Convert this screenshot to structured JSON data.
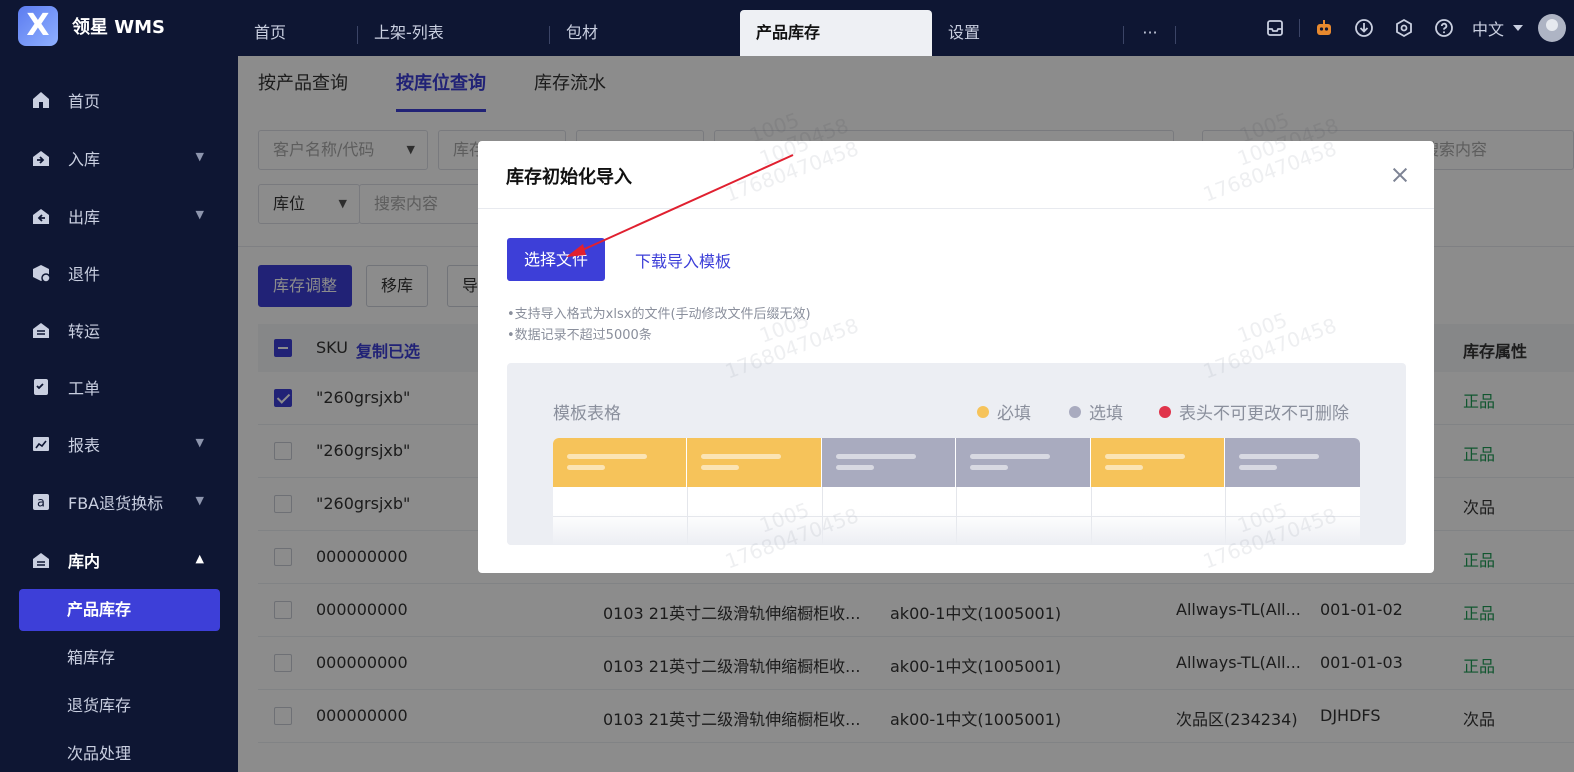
{
  "app": {
    "name": "领星 WMS"
  },
  "topnav": {
    "tabs": [
      {
        "label": "首页"
      },
      {
        "label": "上架-列表"
      },
      {
        "label": "包材"
      },
      {
        "label": "产品库存"
      },
      {
        "label": "设置"
      }
    ],
    "more": "···",
    "lang": "中文"
  },
  "sidebar": {
    "items": [
      {
        "label": "首页",
        "icon": "home-icon"
      },
      {
        "label": "入库",
        "icon": "inbound-icon"
      },
      {
        "label": "出库",
        "icon": "outbound-icon"
      },
      {
        "label": "退件",
        "icon": "return-icon"
      },
      {
        "label": "转运",
        "icon": "transfer-icon"
      },
      {
        "label": "工单",
        "icon": "workorder-icon"
      },
      {
        "label": "报表",
        "icon": "report-icon"
      },
      {
        "label": "FBA退货换标",
        "icon": "amazon-icon"
      },
      {
        "label": "库内",
        "icon": "warehouse-icon"
      }
    ],
    "sub": [
      "产品库存",
      "箱库存",
      "退货库存",
      "次品处理"
    ]
  },
  "subtabs": [
    "按产品查询",
    "按库位查询",
    "库存流水"
  ],
  "filters": {
    "customer_placeholder": "客户名称/代码",
    "warehouse_placeholder": "库存",
    "search_placeholder": "搜索内容",
    "location_label": "库位",
    "location_search_placeholder": "搜索内容",
    "right_search_placeholder": "搜索内容"
  },
  "toolbar": {
    "adjust": "库存调整",
    "move": "移库",
    "third": "导"
  },
  "table": {
    "col_sku": "SKU",
    "copy_selected": "复制已选",
    "col_attr": "库存属性",
    "rows": [
      {
        "sku": "\"260grsjxb\"",
        "name": "",
        "customer": "",
        "area": "",
        "location": "",
        "attr": "正品",
        "good": true,
        "checked": true
      },
      {
        "sku": "\"260grsjxb\"",
        "name": "",
        "customer": "",
        "area": "",
        "location": "",
        "attr": "正品",
        "good": true,
        "checked": false
      },
      {
        "sku": "\"260grsjxb\"",
        "name": "",
        "customer": "",
        "area": "",
        "location": "",
        "attr": "次品",
        "good": false,
        "checked": false
      },
      {
        "sku": "000000000",
        "name": "",
        "customer": "",
        "area": "",
        "location": "",
        "attr": "正品",
        "good": true,
        "checked": false
      },
      {
        "sku": "000000000",
        "name": "0103 21英寸二级滑轨伸缩橱柜收...",
        "customer": "ak00-1中文(1005001)",
        "area": "Allways-TL(All...",
        "location": "001-01-02",
        "attr": "正品",
        "good": true,
        "checked": false
      },
      {
        "sku": "000000000",
        "name": "0103 21英寸二级滑轨伸缩橱柜收...",
        "customer": "ak00-1中文(1005001)",
        "area": "Allways-TL(All...",
        "location": "001-01-03",
        "attr": "正品",
        "good": true,
        "checked": false
      },
      {
        "sku": "000000000",
        "name": "0103 21英寸二级滑轨伸缩橱柜收...",
        "customer": "ak00-1中文(1005001)",
        "area": "次品区(234234)",
        "location": "DJHDFS",
        "attr": "次品",
        "good": false,
        "checked": false
      }
    ]
  },
  "modal": {
    "title": "库存初始化导入",
    "choose_file": "选择文件",
    "download_template": "下载导入模板",
    "note1": "•支持导入格式为xlsx的文件(手动修改文件后缀无效)",
    "note2": "•数据记录不超过5000条",
    "template_title": "模板表格",
    "legend_required": "必填",
    "legend_optional": "选填",
    "legend_locked": "表头不可更改不可删除"
  },
  "colors": {
    "primary": "#3d3fd8",
    "required": "#f6c35a",
    "optional": "#a9abbf",
    "locked": "#e0344b",
    "annotation": "#e02030"
  },
  "watermark": {
    "id": "1005",
    "phone": "17680470458"
  }
}
